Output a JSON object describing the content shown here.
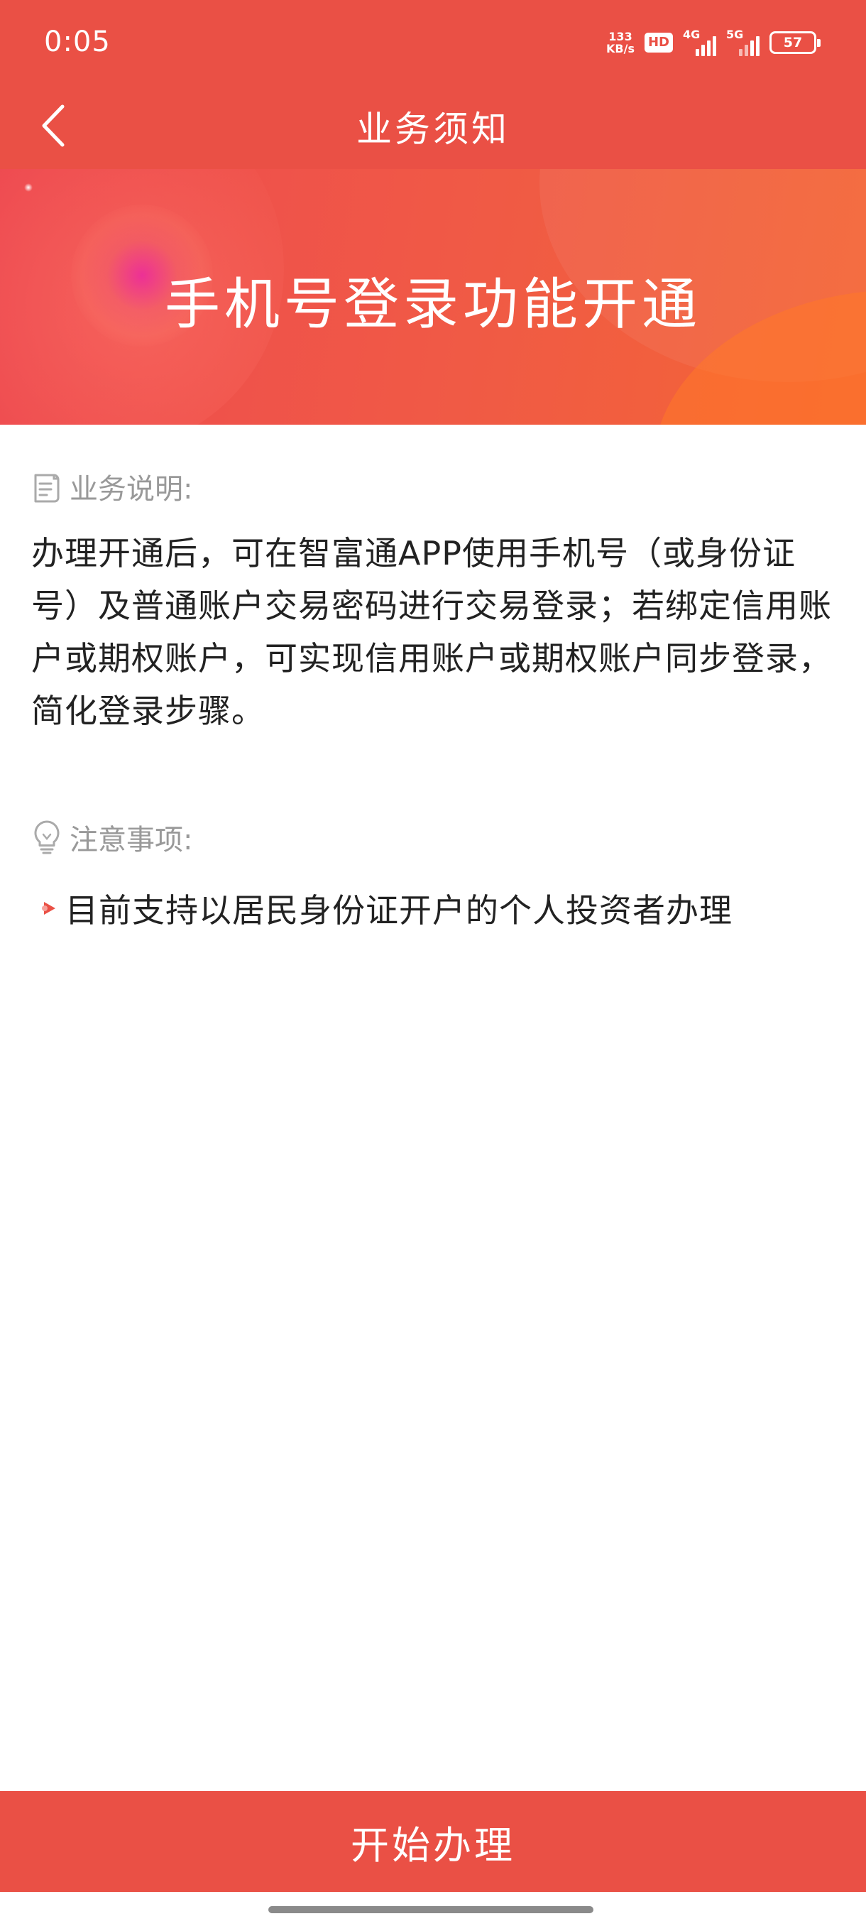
{
  "status_bar": {
    "time": "0:05",
    "speed_value": "133",
    "speed_unit": "KB/s",
    "hd_badge": "HD",
    "network_1": "4G",
    "network_2": "5G",
    "battery": "57"
  },
  "nav": {
    "title": "业务须知",
    "back_icon": "chevron-left-icon"
  },
  "banner": {
    "title": "手机号登录功能开通"
  },
  "description": {
    "header": "业务说明:",
    "icon": "document-icon",
    "text": "办理开通后，可在智富通APP使用手机号（或身份证号）及普通账户交易密码进行交易登录；若绑定信用账户或期权账户，可实现信用账户或期权账户同步登录，简化登录步骤。"
  },
  "notice": {
    "header": "注意事项:",
    "icon": "lightbulb-icon",
    "items": [
      {
        "text": "目前支持以居民身份证开户的个人投资者办理"
      }
    ]
  },
  "action": {
    "button_label": "开始办理"
  },
  "colors": {
    "primary": "#ea5045",
    "secondary_text": "#999999",
    "body_text": "#222222"
  }
}
